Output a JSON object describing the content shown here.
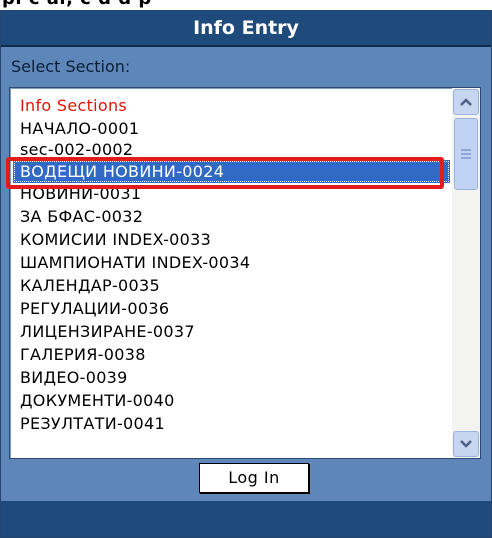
{
  "window": {
    "top_text": "pi c al, c d d p",
    "title": "Info Entry"
  },
  "form": {
    "select_label": "Select Section:",
    "login_label": "Log In"
  },
  "list": {
    "header": "Info Sections",
    "items": [
      "НАЧАЛО-0001",
      "sec-002-0002",
      "ВОДЕЩИ НОВИНИ-0024",
      "НОВИНИ-0031",
      "ЗА БФАС-0032",
      "КОМИСИИ INDEX-0033",
      "ШАМПИОНАТИ INDEX-0034",
      "КАЛЕНДАР-0035",
      "РЕГУЛАЦИИ-0036",
      "ЛИЦЕНЗИРАНЕ-0037",
      "ГАЛЕРИЯ-0038",
      "ВИДЕО-0039",
      "ДОКУМЕНТИ-0040",
      "РЕЗУЛТАТИ-0041"
    ],
    "selected_index": 2
  },
  "icons": {
    "scroll_up": "chevron-up-icon",
    "scroll_down": "chevron-down-icon"
  },
  "colors": {
    "panel_bg": "#5e86b8",
    "title_bg": "#1f4a7c",
    "header_text": "#e3120b",
    "selection_bg": "#316ac5",
    "highlight_border": "#e21b1b"
  }
}
